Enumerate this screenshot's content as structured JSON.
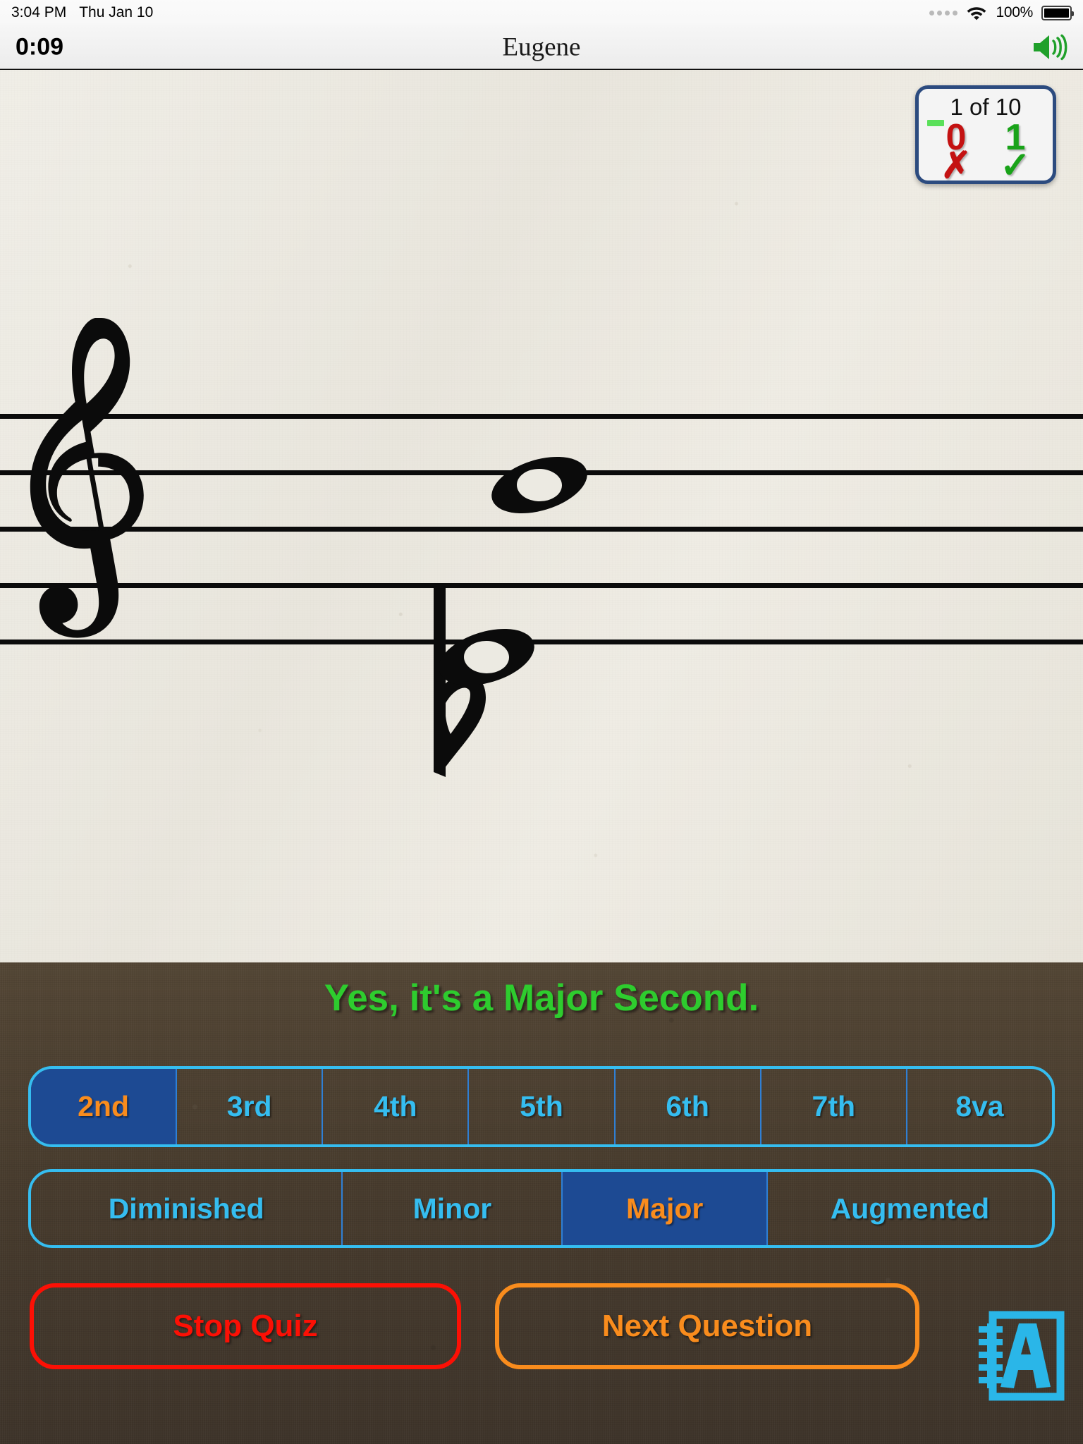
{
  "status_bar": {
    "time": "3:04 PM",
    "date": "Thu Jan 10",
    "battery_percent": "100%",
    "signal_icon": "signal-dots-icon",
    "wifi_icon": "wifi-icon",
    "battery_icon": "battery-full-icon"
  },
  "nav_bar": {
    "timer": "0:09",
    "title": "Eugene",
    "speaker_icon": "speaker-on-icon",
    "speaker_color": "#1fa02a"
  },
  "score_box": {
    "progress": "1 of 10",
    "wrong_count": "0",
    "wrong_mark": "✗",
    "right_count": "1",
    "right_mark": "✓",
    "wrong_color": "#c41212",
    "right_color": "#19a319",
    "border_color": "#2c4b7f",
    "dash_color": "#5ae05a"
  },
  "staff": {
    "clef": "treble-clef",
    "notes": [
      {
        "name": "upper-whole-note",
        "accidental": "none",
        "staff_position": "top-line"
      },
      {
        "name": "lower-whole-note",
        "accidental": "flat",
        "staff_position": "second-line-from-bottom"
      }
    ],
    "line_count": 5
  },
  "feedback": {
    "text": "Yes, it's a Major Second.",
    "color": "#2ecc2e"
  },
  "interval_row": {
    "selected": "2nd",
    "buttons": [
      {
        "label": "2nd",
        "selected": true
      },
      {
        "label": "3rd",
        "selected": false
      },
      {
        "label": "4th",
        "selected": false
      },
      {
        "label": "5th",
        "selected": false
      },
      {
        "label": "6th",
        "selected": false
      },
      {
        "label": "7th",
        "selected": false
      },
      {
        "label": "8va",
        "selected": false
      }
    ]
  },
  "quality_row": {
    "selected": "Major",
    "buttons": [
      {
        "label": "Diminished",
        "selected": false
      },
      {
        "label": "Minor",
        "selected": false
      },
      {
        "label": "Major",
        "selected": true
      },
      {
        "label": "Augmented",
        "selected": false
      }
    ]
  },
  "actions": {
    "stop_quiz": "Stop Quiz",
    "next_question": "Next Question",
    "notebook_icon": "notebook-a-icon",
    "stop_color": "#fc1005",
    "next_color": "#f98c1d",
    "notebook_color": "#2ab6e8"
  },
  "theme": {
    "accent_cyan": "#35bdf0",
    "selected_blue": "#1d4a93",
    "selected_text_orange": "#f98c1d",
    "panel_brown": "#4b3f30",
    "paper_cream": "#eceae2"
  }
}
